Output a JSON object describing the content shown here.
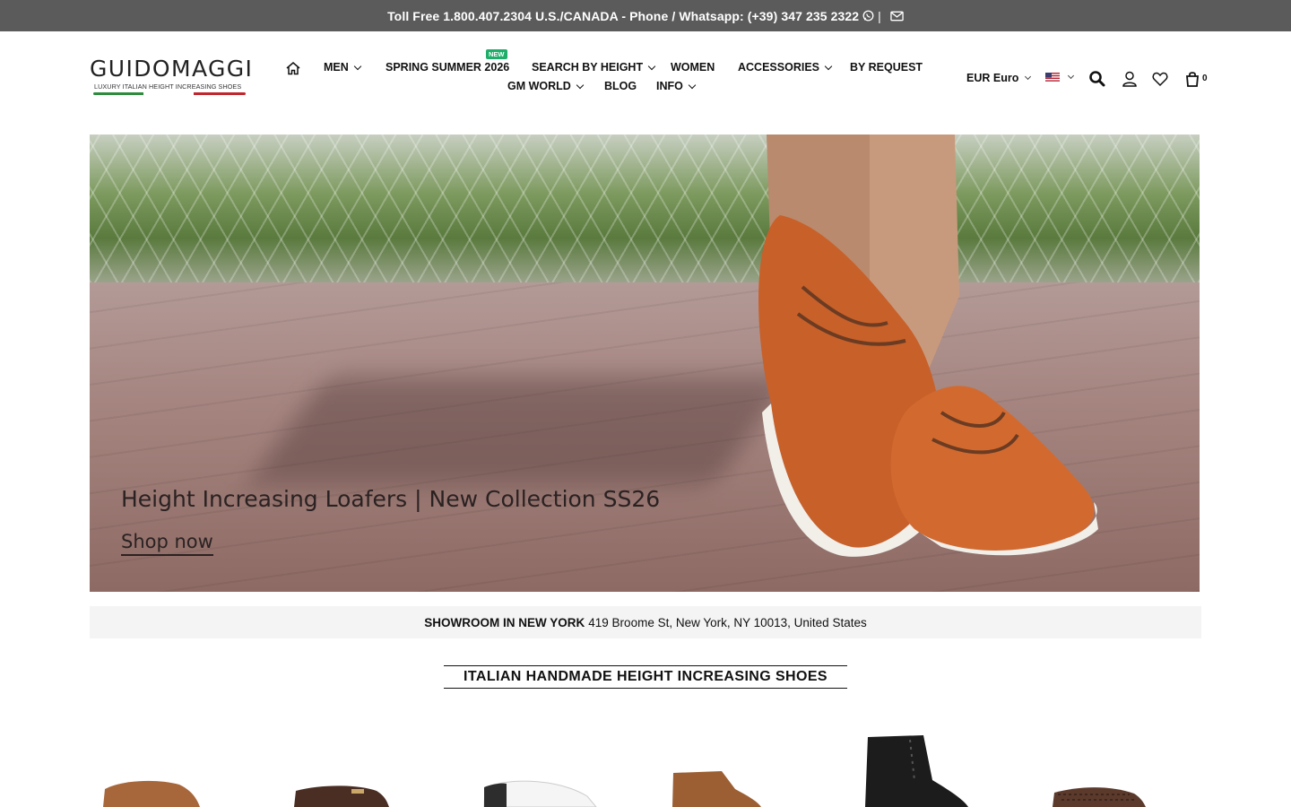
{
  "topbar": {
    "text": "Toll Free 1.800.407.2304 U.S./CANADA - Phone / Whatsapp: (+39) 347 235 2322",
    "separator": "|",
    "whatsapp_icon": "whatsapp-icon",
    "email_icon": "envelope-icon"
  },
  "logo": {
    "brand": "GUIDOMAGGI",
    "tagline": "LUXURY ITALIAN HEIGHT INCREASING SHOES"
  },
  "nav": {
    "home_icon": "home-icon",
    "items": [
      {
        "label": "MEN",
        "dropdown": true
      },
      {
        "label": "SPRING SUMMER 2026",
        "badge": "NEW"
      },
      {
        "label": "SEARCH BY HEIGHT",
        "dropdown": true
      },
      {
        "label": "WOMEN"
      },
      {
        "label": "ACCESSORIES",
        "dropdown": true
      },
      {
        "label": "BY REQUEST"
      },
      {
        "label": "GM WORLD",
        "dropdown": true
      },
      {
        "label": "BLOG"
      },
      {
        "label": "INFO",
        "dropdown": true
      }
    ]
  },
  "header_tools": {
    "currency": "EUR Euro",
    "language_flag": "us-flag-icon",
    "cart_count": "0"
  },
  "hero": {
    "title": "Height Increasing Loafers | New Collection SS26",
    "cta": "Shop now"
  },
  "showroom": {
    "label": "SHOWROOM IN NEW YORK",
    "address": "419 Broome St, New York, NY 10013, United States"
  },
  "section": {
    "title": "ITALIAN HANDMADE HEIGHT INCREASING SHOES"
  },
  "colors": {
    "topbar_bg": "#5b5b5b",
    "new_badge": "#1fae6a",
    "accent_orange": "#c8602a"
  }
}
